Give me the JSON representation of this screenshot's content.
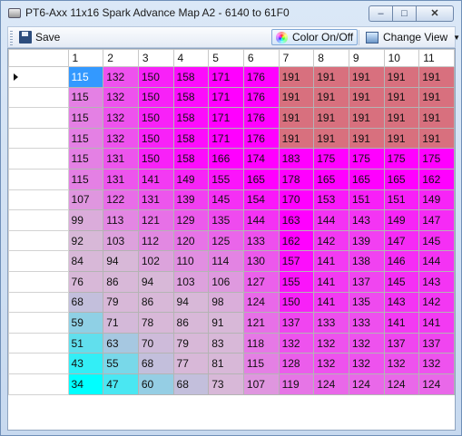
{
  "window": {
    "title": "PT6-Axx 11x16 Spark Advance Map A2 - 6140 to 61F0",
    "minimize": "–",
    "maximize": "□",
    "close": "✕"
  },
  "toolbar": {
    "save_label": "Save",
    "color_label": "Color On/Off",
    "view_label": "Change View"
  },
  "grid": {
    "columns": [
      "1",
      "2",
      "3",
      "4",
      "5",
      "6",
      "7",
      "8",
      "9",
      "10",
      "11"
    ],
    "rows": [
      [
        "115",
        "132",
        "150",
        "158",
        "171",
        "176",
        "191",
        "191",
        "191",
        "191",
        "191"
      ],
      [
        "115",
        "132",
        "150",
        "158",
        "171",
        "176",
        "191",
        "191",
        "191",
        "191",
        "191"
      ],
      [
        "115",
        "132",
        "150",
        "158",
        "171",
        "176",
        "191",
        "191",
        "191",
        "191",
        "191"
      ],
      [
        "115",
        "132",
        "150",
        "158",
        "171",
        "176",
        "191",
        "191",
        "191",
        "191",
        "191"
      ],
      [
        "115",
        "131",
        "150",
        "158",
        "166",
        "174",
        "183",
        "175",
        "175",
        "175",
        "175"
      ],
      [
        "115",
        "131",
        "141",
        "149",
        "155",
        "165",
        "178",
        "165",
        "165",
        "165",
        "162"
      ],
      [
        "107",
        "122",
        "131",
        "139",
        "145",
        "154",
        "170",
        "153",
        "151",
        "151",
        "149"
      ],
      [
        "99",
        "113",
        "121",
        "129",
        "135",
        "144",
        "163",
        "144",
        "143",
        "149",
        "147"
      ],
      [
        "92",
        "103",
        "112",
        "120",
        "125",
        "133",
        "162",
        "142",
        "139",
        "147",
        "145"
      ],
      [
        "84",
        "94",
        "102",
        "110",
        "114",
        "130",
        "157",
        "141",
        "138",
        "146",
        "144"
      ],
      [
        "76",
        "86",
        "94",
        "103",
        "106",
        "127",
        "155",
        "141",
        "137",
        "145",
        "143"
      ],
      [
        "68",
        "79",
        "86",
        "94",
        "98",
        "124",
        "150",
        "141",
        "135",
        "143",
        "142"
      ],
      [
        "59",
        "71",
        "78",
        "86",
        "91",
        "121",
        "137",
        "133",
        "133",
        "141",
        "141"
      ],
      [
        "51",
        "63",
        "70",
        "79",
        "83",
        "118",
        "132",
        "132",
        "132",
        "137",
        "137"
      ],
      [
        "43",
        "55",
        "68",
        "77",
        "81",
        "115",
        "128",
        "132",
        "132",
        "132",
        "132"
      ],
      [
        "34",
        "47",
        "60",
        "68",
        "73",
        "107",
        "119",
        "124",
        "124",
        "124",
        "124"
      ]
    ],
    "selected": {
      "row": 0,
      "col": 0
    },
    "colors": {
      "selection": "#3399ff",
      "min": "#00ffff",
      "mid": "#d8b8d8",
      "max": "#ff00ff",
      "high": "#d8707e"
    }
  }
}
